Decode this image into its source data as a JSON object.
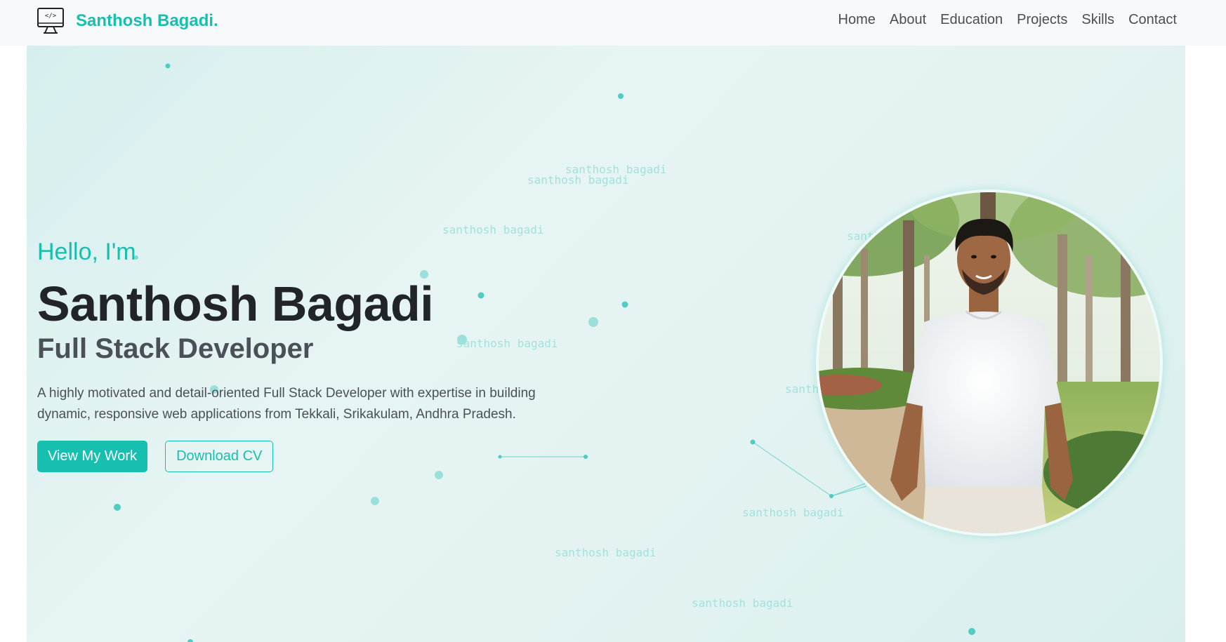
{
  "navbar": {
    "brand_icon": "monitor-code-icon",
    "brand_icon_text": "</>",
    "brand_name": "Santhosh Bagadi.",
    "links": [
      "Home",
      "About",
      "Education",
      "Projects",
      "Skills",
      "Contact"
    ]
  },
  "hero": {
    "greeting": "Hello, I'm",
    "name": "Santhosh Bagadi",
    "role": "Full Stack Developer",
    "description": "A highly motivated and detail-oriented Full Stack Developer with expertise in building dynamic, responsive web applications from Tekkali, Srikakulam, Andhra Pradesh.",
    "primary_button": "View My Work",
    "secondary_button": "Download CV",
    "watermark_text": "santhosh bagadi",
    "photo_alt": "profile-photo"
  },
  "colors": {
    "accent": "#17bfae",
    "navbar_bg": "#f8f9fa",
    "hero_bg": "#e4f3f2",
    "heading": "#212529",
    "watermark": "#a2e2dc"
  }
}
